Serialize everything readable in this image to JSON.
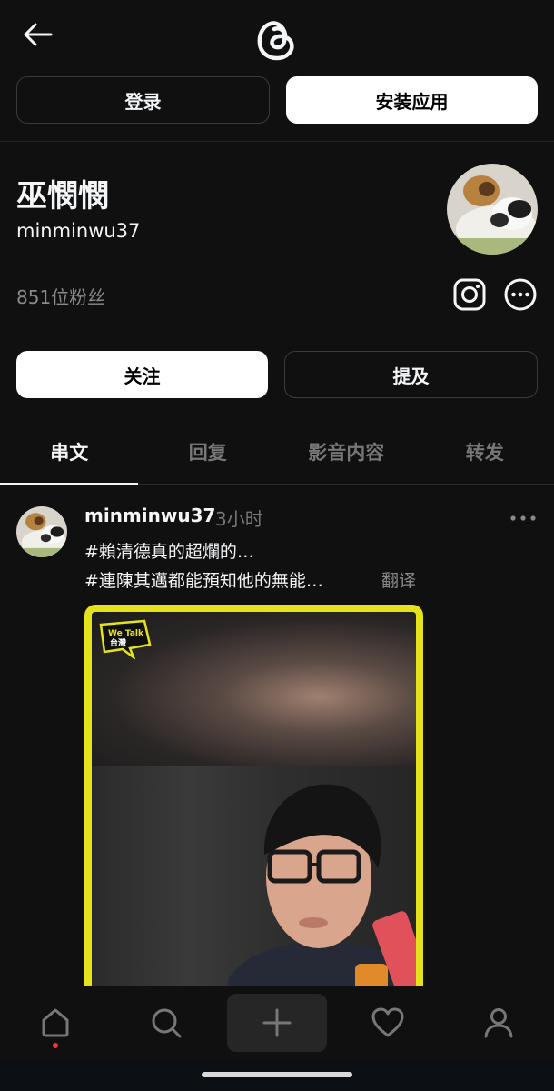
{
  "header": {
    "back_icon": "arrow-left-icon",
    "logo_icon": "threads-logo-icon"
  },
  "auth": {
    "login_label": "登录",
    "install_label": "安装应用"
  },
  "profile": {
    "name": "巫憫憫",
    "handle": "minminwu37",
    "followers": "851位粉丝",
    "instagram_icon": "instagram-icon",
    "more_icon": "more-circle-icon"
  },
  "actions": {
    "follow_label": "关注",
    "mention_label": "提及"
  },
  "tabs": [
    {
      "label": "串文",
      "active": true
    },
    {
      "label": "回复",
      "active": false
    },
    {
      "label": "影音内容",
      "active": false
    },
    {
      "label": "转发",
      "active": false
    }
  ],
  "post": {
    "user": "minminwu37",
    "time": "3小时",
    "line1": "#賴清德真的超爛的…",
    "line2": "#連陳其邁都能預知他的無能…",
    "translate": "翻译",
    "media_logo_text": "We Talk 台灣"
  },
  "nav": {
    "items": [
      "home-icon",
      "search-icon",
      "plus-icon",
      "heart-icon",
      "profile-icon"
    ]
  },
  "colors": {
    "background": "#101010",
    "media_border": "#e5e21b",
    "notification_dot": "#ff3040"
  }
}
